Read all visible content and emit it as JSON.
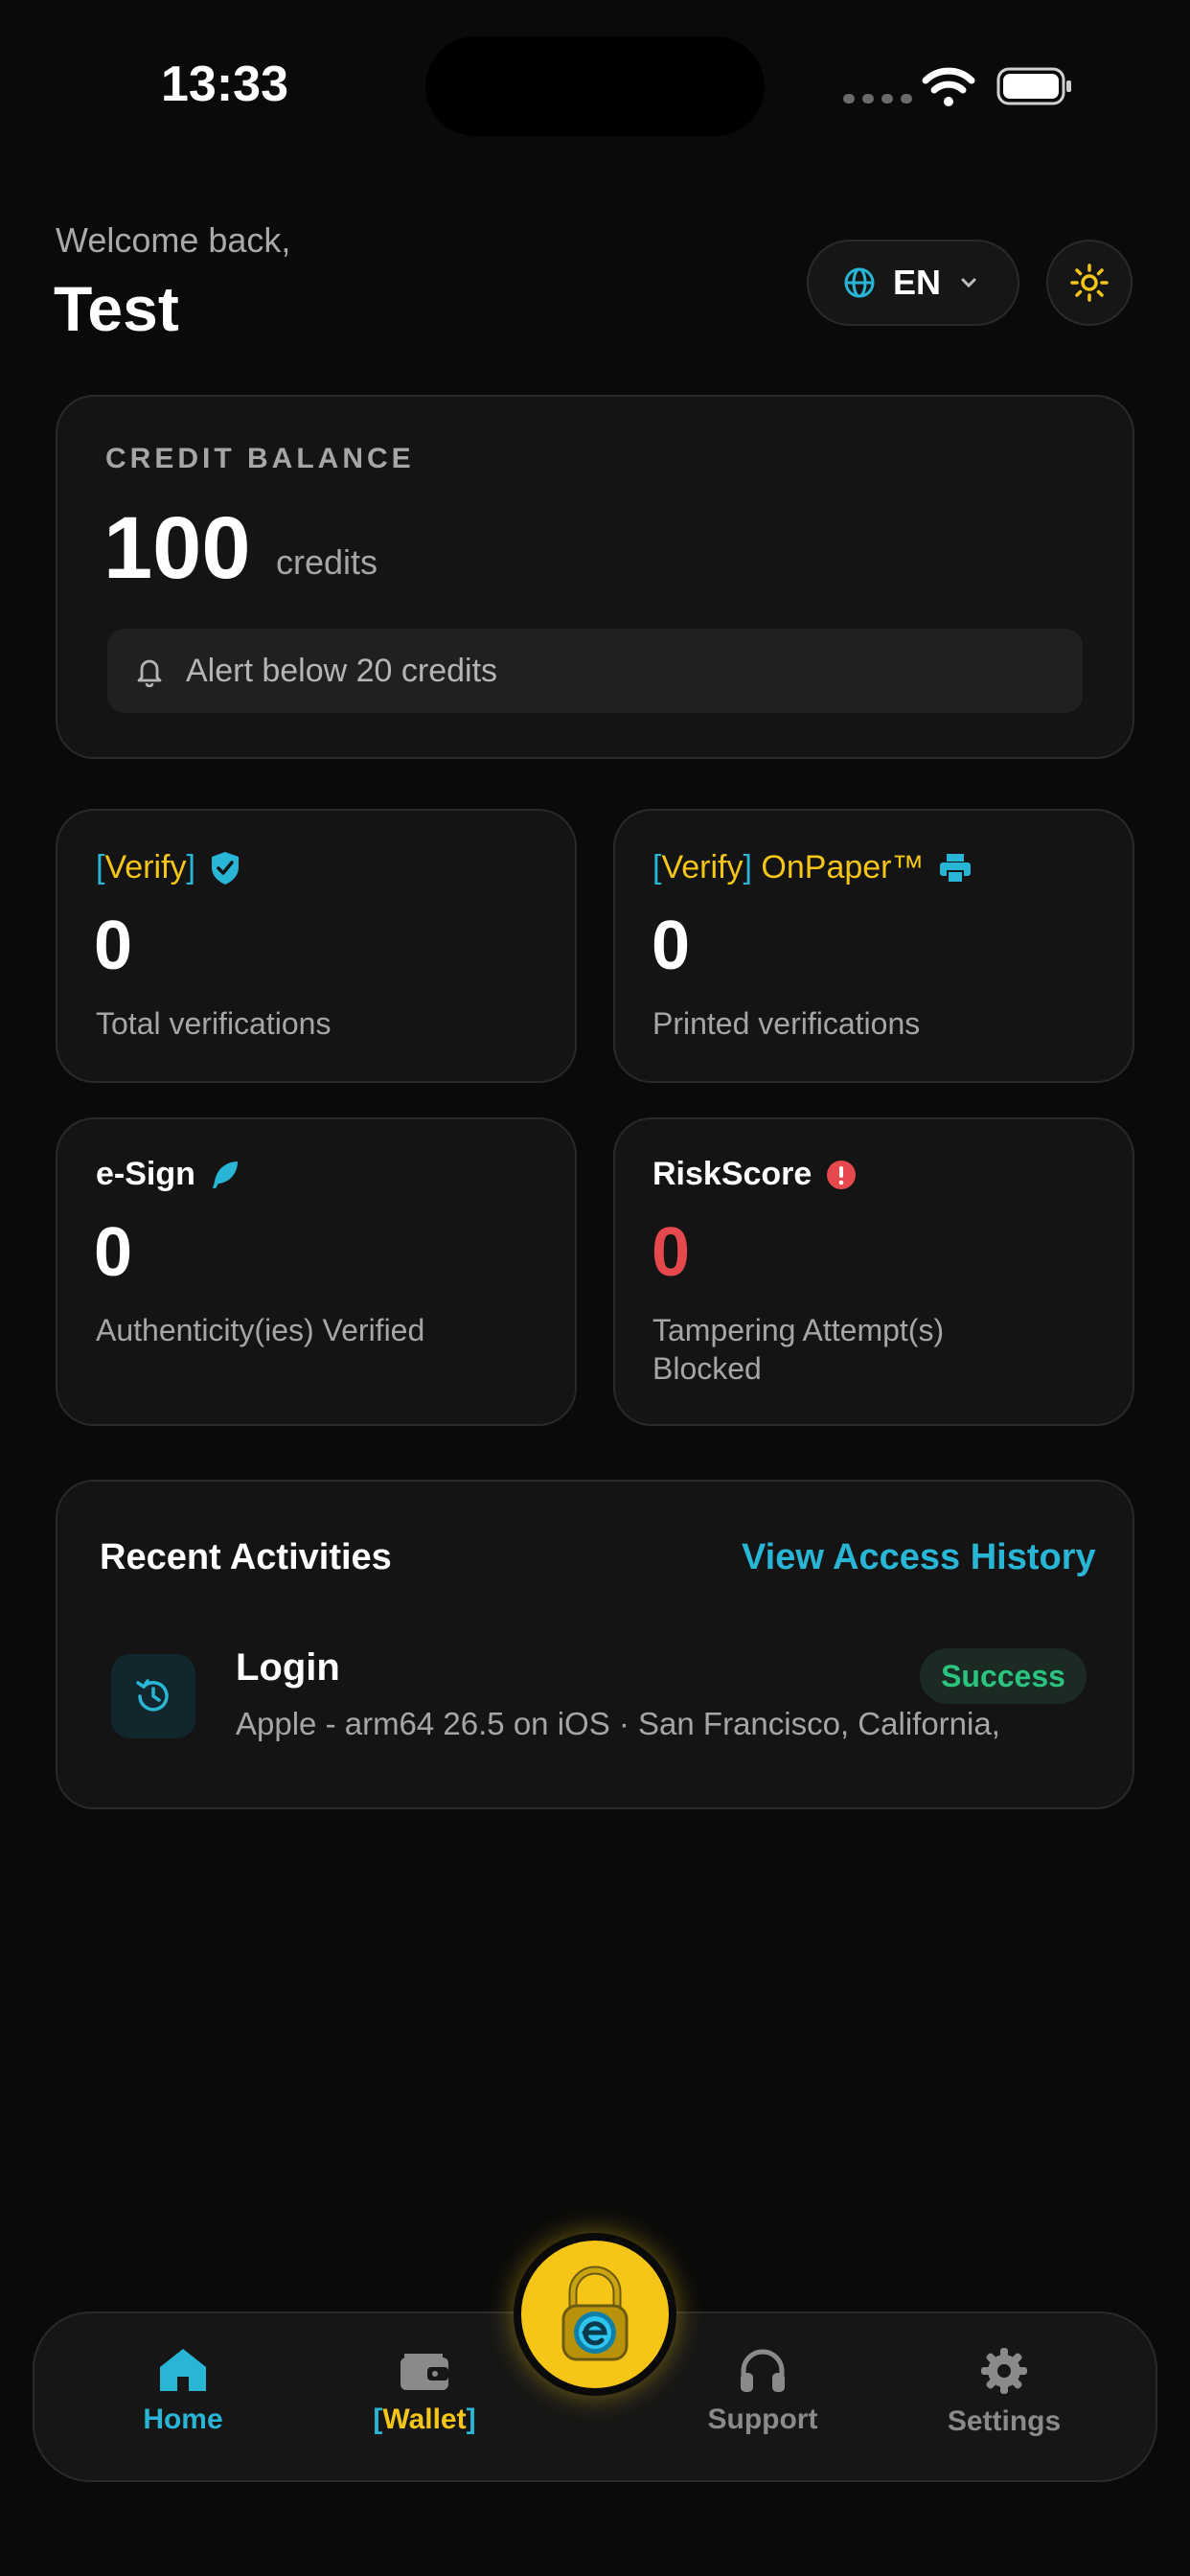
{
  "status_bar": {
    "time": "13:33"
  },
  "header": {
    "welcome": "Welcome back,",
    "username": "Test",
    "language_code": "EN",
    "icons": {
      "language": "globe-icon",
      "theme": "sun-icon"
    }
  },
  "balance": {
    "label": "CREDIT BALANCE",
    "value": "100",
    "unit": "credits",
    "alert_text": "Alert below 20 credits"
  },
  "stats": [
    {
      "bracket_open": "[",
      "brand": "Verify",
      "bracket_close": "]",
      "suffix": "",
      "value": "0",
      "desc": "Total verifications",
      "icon": "shield-check-icon"
    },
    {
      "bracket_open": "[",
      "brand": "Verify",
      "bracket_close": "]",
      "suffix": "OnPaper™",
      "value": "0",
      "desc": "Printed verifications",
      "icon": "printer-icon"
    },
    {
      "title": "e-Sign",
      "value": "0",
      "desc": "Authenticity(ies) Verified",
      "icon": "feather-icon"
    },
    {
      "title": "RiskScore",
      "value": "0",
      "desc_line1": "Tampering Attempt(s)",
      "desc_line2": "Blocked",
      "icon": "alert-circle-icon"
    }
  ],
  "activities": {
    "title": "Recent Activities",
    "link": "View Access History",
    "items": [
      {
        "name": "Login",
        "meta": "Apple - arm64 26.5 on iOS  ·  San Francisco, California,",
        "status": "Success",
        "icon": "history-icon"
      }
    ]
  },
  "tabs": {
    "home": "Home",
    "wallet_open": "[",
    "wallet": "Wallet",
    "wallet_close": "]",
    "support": "Support",
    "settings": "Settings"
  },
  "colors": {
    "accent": "#29b6d6",
    "brand_yellow": "#f5c518",
    "danger": "#e5484d",
    "success": "#2bc47e",
    "background": "#0a0a0a",
    "card": "#141414"
  }
}
